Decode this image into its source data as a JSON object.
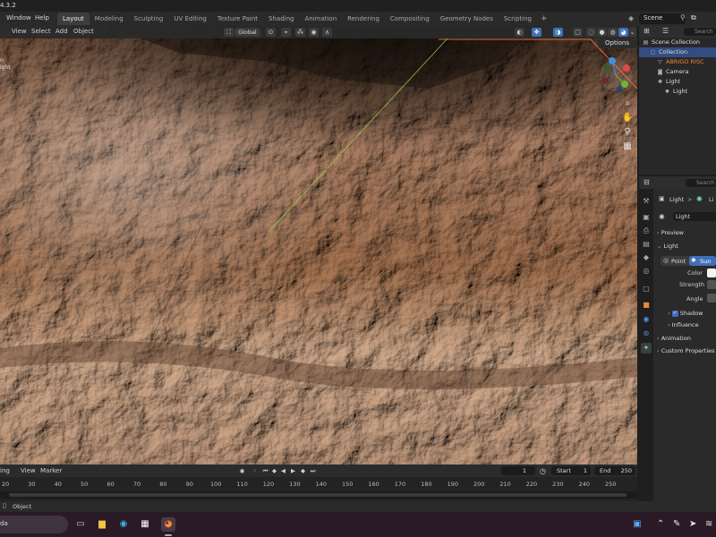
{
  "window": {
    "title_fragment": "4.3.2"
  },
  "topbar": {
    "menus": [
      "Window",
      "Help"
    ],
    "tabs": [
      "Layout",
      "Modeling",
      "Sculpting",
      "UV Editing",
      "Texture Paint",
      "Shading",
      "Animation",
      "Rendering",
      "Compositing",
      "Geometry Nodes",
      "Scripting"
    ],
    "active_tab": "Layout",
    "add_tab_label": "+",
    "scene_label": "Scene"
  },
  "viewport": {
    "menus": [
      "View",
      "Select",
      "Add",
      "Object"
    ],
    "orientation": "Global",
    "options_label": "Options",
    "left_overlay": [
      "n",
      "ight"
    ]
  },
  "outliner": {
    "search_placeholder": "Search",
    "rows": [
      {
        "label": "Scene Collection",
        "icon": "scene-collection-icon",
        "indent": 0,
        "selected": false
      },
      {
        "label": "Collection",
        "icon": "collection-icon",
        "indent": 1,
        "selected": true
      },
      {
        "label": "ABRIGO RISC",
        "icon": "mesh-icon",
        "indent": 2,
        "selected": false,
        "accent": "#e8873a"
      },
      {
        "label": "Camera",
        "icon": "camera-icon",
        "indent": 2,
        "selected": false
      },
      {
        "label": "Light",
        "icon": "light-icon",
        "indent": 2,
        "selected": false
      },
      {
        "label": "Light",
        "icon": "light-data-icon",
        "indent": 3,
        "selected": false
      }
    ]
  },
  "properties": {
    "search_placeholder": "Search",
    "breadcrumb": "Light",
    "breadcrumb_tail": "Li",
    "datablock_name": "Light",
    "sections": {
      "preview": "Preview",
      "light": "Light",
      "shadow": "Shadow",
      "influence": "Influence",
      "animation": "Animation",
      "custom_properties": "Custom Properties"
    },
    "light_types": [
      "Point",
      "Sun"
    ],
    "selected_light_type": "Sun",
    "labels": {
      "color": "Color",
      "strength": "Strength",
      "angle": "Angle"
    },
    "shadow_checked": true
  },
  "timeline": {
    "menus": [
      "ing",
      "View",
      "Marker"
    ],
    "current_frame": "1",
    "start_label": "Start",
    "start_value": "1",
    "end_label": "End",
    "end_value": "250",
    "ticks": [
      "20",
      "30",
      "40",
      "50",
      "60",
      "70",
      "80",
      "90",
      "100",
      "110",
      "120",
      "130",
      "140",
      "150",
      "160",
      "170",
      "180",
      "190",
      "200",
      "210",
      "220",
      "230",
      "240",
      "250"
    ]
  },
  "statusbar": {
    "text": "Object"
  },
  "taskbar": {
    "search_fragment": "da"
  },
  "colors": {
    "accent_blue": "#3f6fb5",
    "selection_blue": "#334d80",
    "rock_orange": "#e8873a",
    "light_green": "#5fcf9f"
  }
}
